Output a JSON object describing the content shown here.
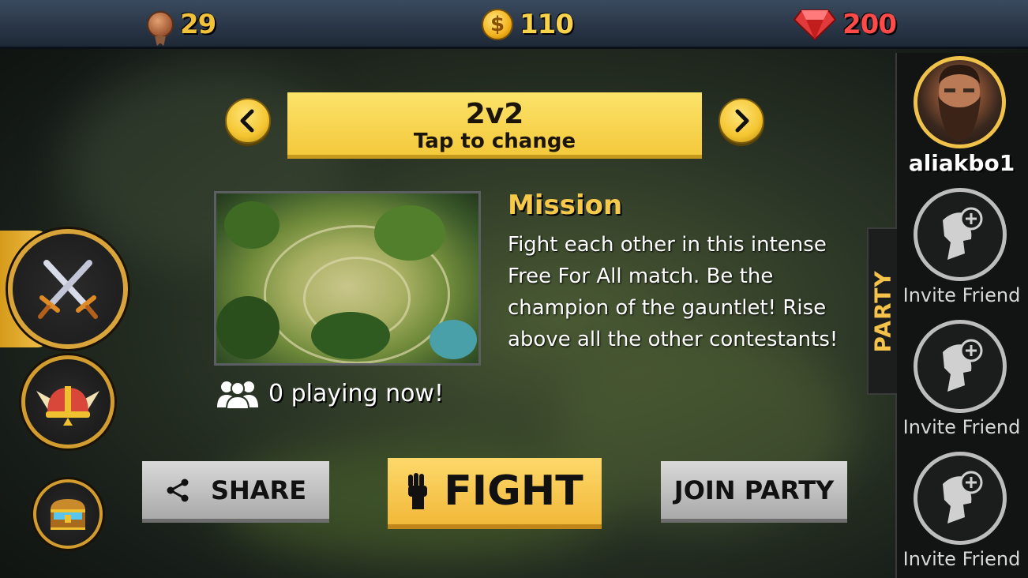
{
  "currency": {
    "medals": "29",
    "coins": "110",
    "coin_symbol": "$",
    "gems": "200",
    "gem_color": "#e23a3a",
    "coin_color": "#f2b21c",
    "medal_color": "#b36a40"
  },
  "mode_selector": {
    "mode": "2v2",
    "subtitle": "Tap to change",
    "prev_icon": "chevron-left-icon",
    "next_icon": "chevron-right-icon"
  },
  "mission": {
    "title": "Mission",
    "description": "Fight each other in this intense Free For All match. Be the champion of the gauntlet! Rise above all the other contestants!"
  },
  "players": {
    "text": "0 playing now!",
    "icon": "group-icon"
  },
  "buttons": {
    "share": "SHARE",
    "fight": "FIGHT",
    "join_party": "JOIN PARTY"
  },
  "party": {
    "tab_label": "PARTY",
    "username": "aliakbo1",
    "invite_slots": [
      {
        "label": "Invite Friend"
      },
      {
        "label": "Invite Friend"
      },
      {
        "label": "Invite Friend"
      }
    ]
  },
  "sidebar": {
    "items": [
      {
        "icon": "crossed-swords-icon"
      },
      {
        "icon": "winged-helmet-icon"
      },
      {
        "icon": "treasure-chest-icon"
      }
    ]
  },
  "colors": {
    "accent_yellow": "#f4c93c",
    "title_yellow": "#f7c94a"
  }
}
